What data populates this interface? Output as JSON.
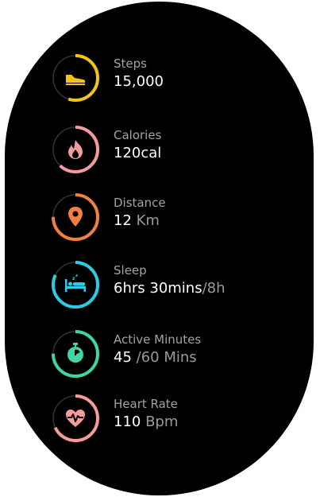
{
  "stats": [
    {
      "label": "Steps",
      "value": "15,000",
      "value_sub": "",
      "color": "#f2c418",
      "progress": 0.55,
      "icon": "shoe-icon"
    },
    {
      "label": "Calories",
      "value": "120cal",
      "value_sub": "",
      "color": "#f59b9b",
      "progress": 0.62,
      "icon": "flame-icon"
    },
    {
      "label": "Distance",
      "value": "12",
      "value_sub": " Km",
      "color": "#f0813f",
      "progress": 0.75,
      "icon": "location-pin-icon"
    },
    {
      "label": "Sleep",
      "value": "6hrs 30mins",
      "value_sub": "/8h",
      "color": "#2ecbe6",
      "progress": 0.82,
      "icon": "bed-icon"
    },
    {
      "label": "Active Minutes",
      "value": "45",
      "value_sub": " /60 Mins",
      "color": "#3ed6a6",
      "progress": 0.75,
      "icon": "stopwatch-icon"
    },
    {
      "label": "Heart Rate",
      "value": "110",
      "value_sub": " Bpm",
      "color": "#f59b9b",
      "progress": 0.68,
      "icon": "heart-rate-icon"
    }
  ]
}
